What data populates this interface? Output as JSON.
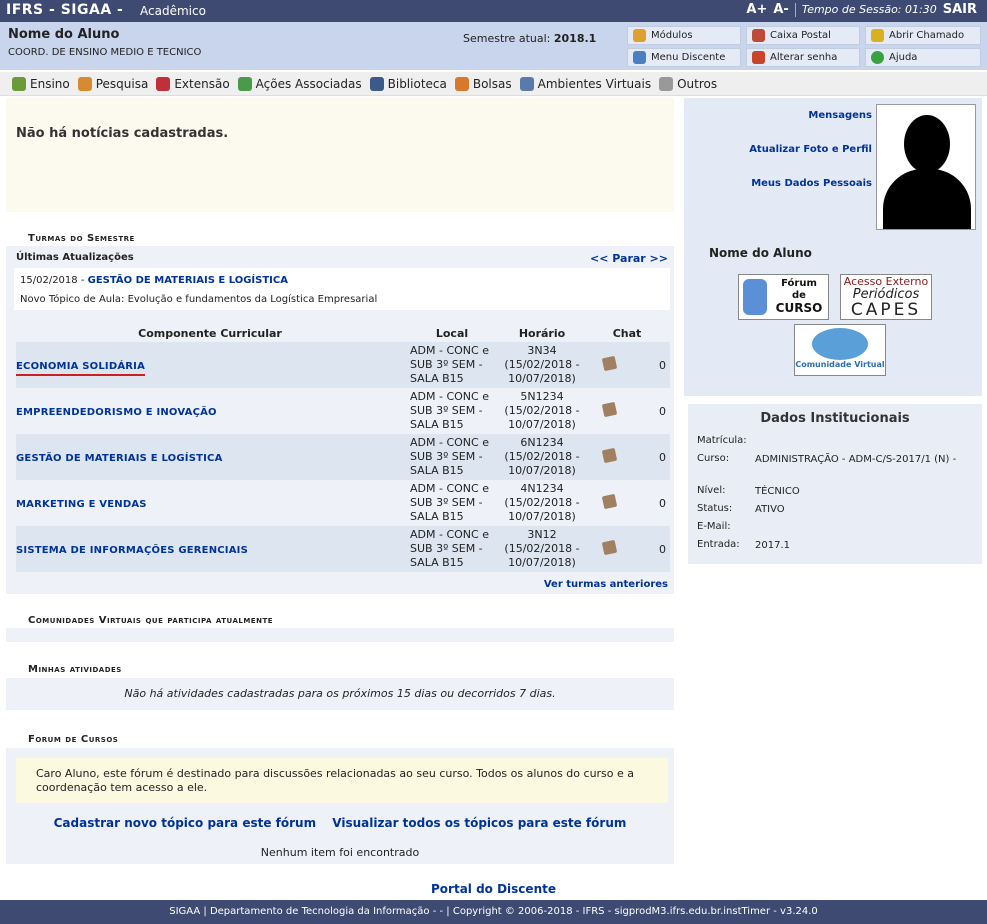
{
  "topbar": {
    "brand": "IFRS - SIGAA -",
    "module": "Acadêmico",
    "font_up": "A+",
    "font_down": "A-",
    "session_label": "Tempo de Sessão: 01:30",
    "logout": "SAIR"
  },
  "user": {
    "name": "Nome do Aluno",
    "unit": "COORD. DE ENSINO MEDIO E TECNICO",
    "semester_label": "Semestre atual:",
    "semester_value": "2018.1"
  },
  "quick": {
    "modulos": "Módulos",
    "caixa": "Caixa Postal",
    "chamado": "Abrir Chamado",
    "menu_discente": "Menu Discente",
    "senha": "Alterar senha",
    "ajuda": "Ajuda"
  },
  "menu": [
    "Ensino",
    "Pesquisa",
    "Extensão",
    "Ações Associadas",
    "Biblioteca",
    "Bolsas",
    "Ambientes Virtuais",
    "Outros"
  ],
  "news": "Não há notícias cadastradas.",
  "turmas": {
    "title": "Turmas do Semestre",
    "updates_head": "Últimas Atualizações",
    "updates_nav": "<< Parar >>",
    "update_date": "15/02/2018 -",
    "update_course": "GESTÃO DE MATERIAIS E LOGÍSTICA",
    "update_topic": "Novo Tópico de Aula: Evolução e fundamentos da Logística Empresarial",
    "headers": {
      "comp": "Componente Curricular",
      "local": "Local",
      "horario": "Horário",
      "chat": "Chat"
    },
    "rows": [
      {
        "comp": "ECONOMIA SOLIDÁRIA",
        "local": "ADM - CONC e SUB 3º SEM - SALA B15",
        "horario": "3N34 (15/02/2018 - 10/07/2018)",
        "count": "0"
      },
      {
        "comp": "EMPREENDEDORISMO E INOVAÇÃO",
        "local": "ADM - CONC e SUB 3º SEM - SALA B15",
        "horario": "5N1234 (15/02/2018 - 10/07/2018)",
        "count": "0"
      },
      {
        "comp": "GESTÃO DE MATERIAIS E LOGÍSTICA",
        "local": "ADM - CONC e SUB 3º SEM - SALA B15",
        "horario": "6N1234 (15/02/2018 - 10/07/2018)",
        "count": "0"
      },
      {
        "comp": "MARKETING E VENDAS",
        "local": "ADM - CONC e SUB 3º SEM - SALA B15",
        "horario": "4N1234 (15/02/2018 - 10/07/2018)",
        "count": "0"
      },
      {
        "comp": "SISTEMA DE INFORMAÇÕES GERENCIAIS",
        "local": "ADM - CONC e SUB 3º SEM - SALA B15",
        "horario": "3N12 (15/02/2018 - 10/07/2018)",
        "count": "0"
      }
    ],
    "more": "Ver turmas anteriores"
  },
  "comunidades": {
    "title": "Comunidades Virtuais que participa atualmente"
  },
  "atividades": {
    "title": "Minhas atividades",
    "text": "Não há atividades cadastradas para os próximos 15 dias ou decorridos 7 dias."
  },
  "forum": {
    "title": "Forum de Cursos",
    "notice": "Caro Aluno, este fórum é destinado para discussões relacionadas ao seu curso. Todos os alunos do curso e a coordenação tem acesso a ele.",
    "link_new": "Cadastrar novo tópico para este fórum",
    "link_all": "Visualizar todos os tópicos para este fórum",
    "none": "Nenhum item foi encontrado"
  },
  "portal": "Portal do Discente",
  "footer": "SIGAA | Departamento de Tecnologia da Informação - - | Copyright © 2006-2018 - IFRS - sigprodM3.ifrs.edu.br.instTimer - v3.24.0",
  "profile": {
    "mensagens": "Mensagens",
    "foto": "Atualizar Foto e Perfil",
    "dados": "Meus Dados Pessoais",
    "name": "Nome do Aluno"
  },
  "ext": {
    "forum_l1": "Fórum",
    "forum_l2": "de",
    "forum_l3": "CURSO",
    "capes_l1": "Acesso Externo",
    "capes_l2": "Periódicos",
    "capes_l3": "CAPES",
    "comm": "Comunidade Virtual"
  },
  "inst": {
    "title": "Dados Institucionais",
    "rows": [
      {
        "k": "Matrícula:",
        "v": ""
      },
      {
        "k": "Curso:",
        "v": "ADMINISTRAÇÃO - ADM-C/S-2017/1 (N) -"
      },
      {
        "k": "Nível:",
        "v": "TÉCNICO"
      },
      {
        "k": "Status:",
        "v": "ATIVO"
      },
      {
        "k": "E-Mail:",
        "v": ""
      },
      {
        "k": "Entrada:",
        "v": "2017.1"
      }
    ]
  },
  "colors": {
    "bar": "#3f4a72",
    "header": "#c8d5ec",
    "link": "#003399",
    "panel": "#eef2f8"
  }
}
